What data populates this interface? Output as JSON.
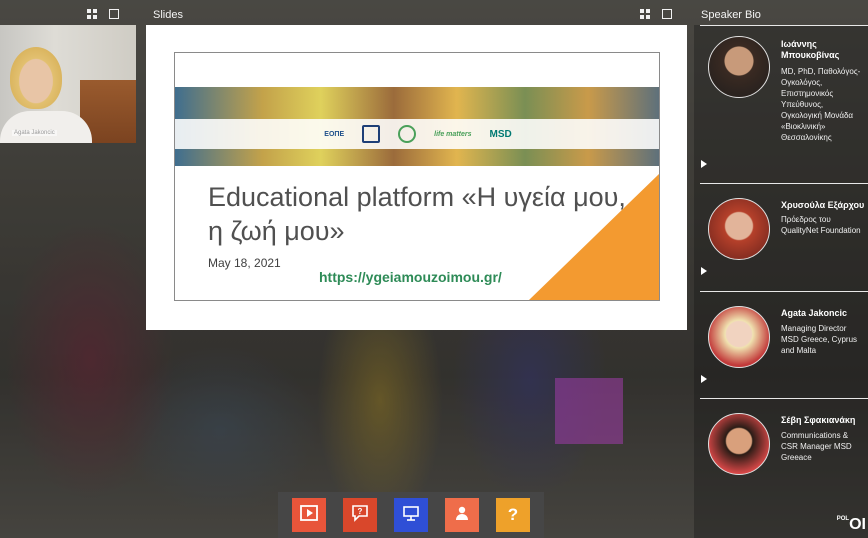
{
  "video": {
    "participant_name": "Agata Jakoncic"
  },
  "slides": {
    "panel_title": "Slides",
    "slide_title": "Educational platform «Η υγεία μου, η ζωή μου»",
    "slide_date": "May 18, 2021",
    "slide_url": "https://ygeiamouzoimou.gr/",
    "logos": [
      "ΕΟΠΕ",
      "",
      "",
      "life matters",
      "MSD"
    ]
  },
  "bio": {
    "panel_title": "Speaker Bio",
    "speakers": [
      {
        "name": "Ιωάννης Μπουκοβίνας",
        "role": "MD, PhD, Παθολόγος-Ογκολόγος, Επιστημονικός Υπεύθυνος, Ογκολογική Μονάδα «Βιοκλινική» Θεσσαλονίκης"
      },
      {
        "name": "Χρυσούλα Εξάρχου",
        "role": "Πρόεδρος του QualityNet Foundation"
      },
      {
        "name": "Agata Jakoncic",
        "role": "Managing Director MSD Greece, Cyprus and Malta"
      },
      {
        "name": "Σέβη Σφακιανάκη",
        "role": "Communications & CSR Manager MSD Greeace"
      }
    ]
  },
  "toolbar": {
    "buttons": [
      {
        "icon": "video-play-icon",
        "color": "#e8553a"
      },
      {
        "icon": "question-chat-icon",
        "color": "#d9472b"
      },
      {
        "icon": "presentation-icon",
        "color": "#2f4fd6"
      },
      {
        "icon": "person-icon",
        "color": "#ef6d4a"
      },
      {
        "icon": "help-icon",
        "color": "#eea12a"
      }
    ],
    "help_label": "?"
  },
  "colors": {
    "accent_orange": "#f39a30",
    "url_green": "#2e8b57",
    "toolbar_bg": "#464646"
  },
  "branding": {
    "footer_logo": "OI",
    "footer_logo_small": "POL"
  }
}
